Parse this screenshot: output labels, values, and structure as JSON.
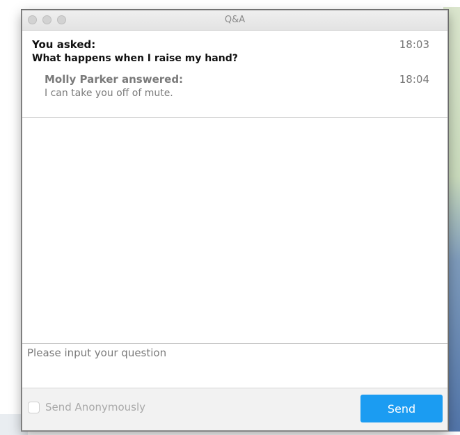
{
  "window": {
    "title": "Q&A"
  },
  "questions": [
    {
      "asker_label": "You asked:",
      "text": "What happens when I raise my hand?",
      "time": "18:03",
      "answer": {
        "answerer_label": "Molly Parker answered:",
        "text": "I can take you off of mute.",
        "time": "18:04"
      }
    }
  ],
  "input": {
    "placeholder": "Please input your question",
    "value": ""
  },
  "footer": {
    "anonymous_label": "Send Anonymously",
    "anonymous_checked": false,
    "send_label": "Send"
  },
  "colors": {
    "send_button": "#1b9cf2",
    "muted_text": "#7a7a7a"
  }
}
